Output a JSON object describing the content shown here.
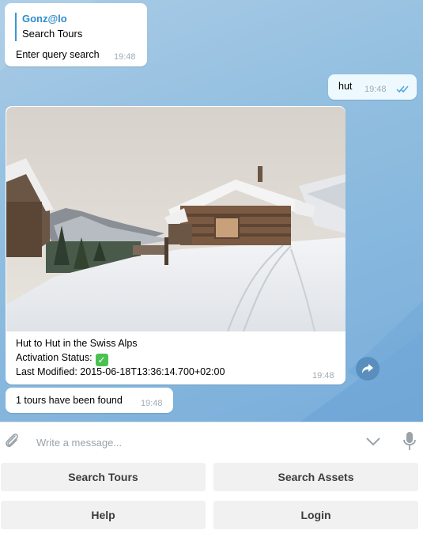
{
  "messages": {
    "bot_query": {
      "reply_name": "Gonz@lo",
      "reply_text": "Search Tours",
      "text": "Enter query search",
      "time": "19:48"
    },
    "user_msg": {
      "text": "hut",
      "time": "19:48"
    },
    "tour_card": {
      "title": "Hut to Hut in the Swiss Alps",
      "status_label": "Activation Status:",
      "status_icon": "check-mark-icon",
      "modified": "Last Modified: 2015-06-18T13:36:14.700+02:00",
      "time": "19:48"
    },
    "result_msg": {
      "text": "1 tours have been found",
      "time": "19:48"
    }
  },
  "composer": {
    "placeholder": "Write a message..."
  },
  "keyboard": {
    "search_tours": "Search Tours",
    "search_assets": "Search Assets",
    "help": "Help",
    "login": "Login"
  },
  "colors": {
    "accent": "#2e8ccb",
    "read_ticks": "#4ea4dc",
    "status_green": "#4bc152"
  }
}
